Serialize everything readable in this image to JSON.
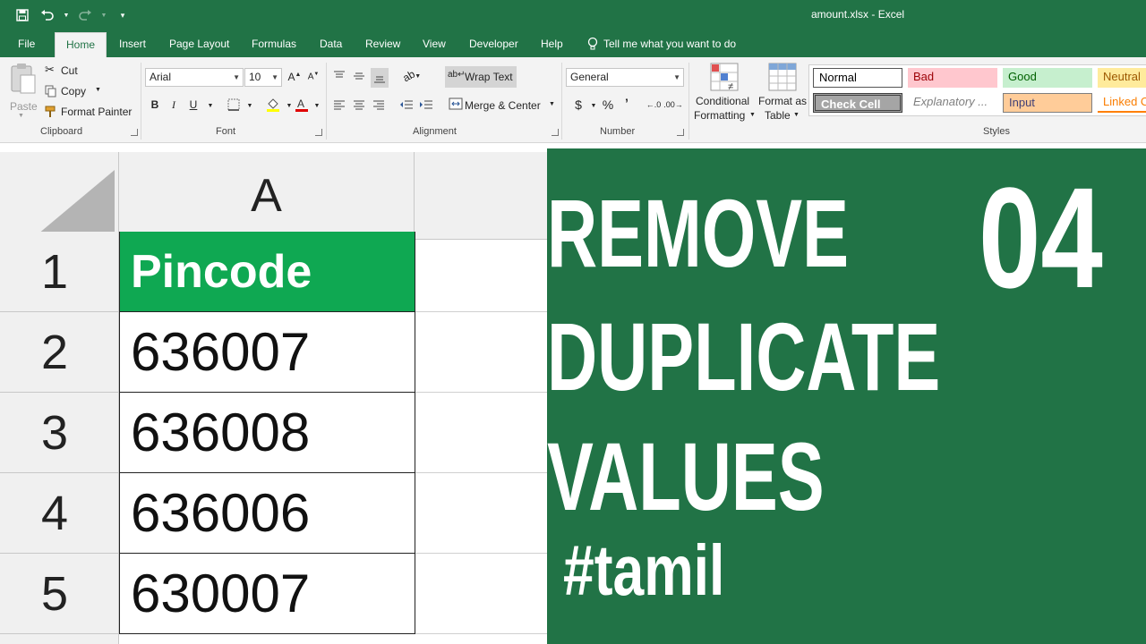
{
  "titlebar": {
    "title": "amount.xlsx - Excel"
  },
  "tabs": [
    "File",
    "Home",
    "Insert",
    "Page Layout",
    "Formulas",
    "Data",
    "Review",
    "View",
    "Developer",
    "Help"
  ],
  "tell_me": "Tell me what you want to do",
  "ribbon": {
    "clipboard": {
      "label": "Clipboard",
      "paste": "Paste",
      "cut": "Cut",
      "copy": "Copy",
      "format_painter": "Format Painter"
    },
    "font": {
      "label": "Font",
      "font_name": "Arial",
      "font_size": "10",
      "bold": "B",
      "italic": "I",
      "underline": "U"
    },
    "alignment": {
      "label": "Alignment",
      "wrap_text": "Wrap Text",
      "merge_center": "Merge & Center"
    },
    "number": {
      "label": "Number",
      "format": "General",
      "currency": "$",
      "percent": "%",
      "comma": "’"
    },
    "styles": {
      "label": "Styles",
      "conditional_1": "Conditional",
      "conditional_2": "Formatting",
      "format_table_1": "Format as",
      "format_table_2": "Table",
      "normal": "Normal",
      "bad": "Bad",
      "good": "Good",
      "neutral": "Neutral",
      "check_cell": "Check Cell",
      "explanatory": "Explanatory ...",
      "input": "Input",
      "linked": "Linked C"
    }
  },
  "sheet": {
    "column_header": "A",
    "rows": [
      {
        "num": "1",
        "value": "Pincode"
      },
      {
        "num": "2",
        "value": "636007"
      },
      {
        "num": "3",
        "value": "636008"
      },
      {
        "num": "4",
        "value": "636006"
      },
      {
        "num": "5",
        "value": "630007"
      }
    ]
  },
  "banner": {
    "line1": "REMOVE",
    "number": "04",
    "line2": "DUPLICATE",
    "line3": "VALUES",
    "tag": "#tamil"
  },
  "colors": {
    "excel_green": "#217346",
    "header_cell_green": "#0fa852"
  }
}
